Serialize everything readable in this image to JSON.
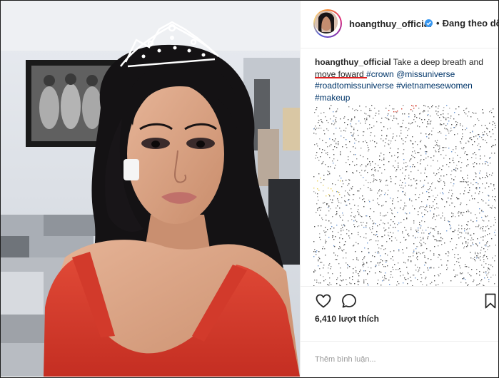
{
  "header": {
    "username": "hoangthuy_official",
    "follow_separator": "•",
    "follow_label": "Đang theo dõ",
    "verified_icon": "verified-badge-icon"
  },
  "caption": {
    "username": "hoangthuy_official",
    "text_1": " Take a deep breath and ",
    "text_2": "move foward",
    "hashtag_crown": "#crown",
    "mention": "@missuniverse",
    "hashtag_road": "#roadtomissuniverse",
    "hashtag_vn": "#vietnamesewomen",
    "hashtag_makeup": "#makeup"
  },
  "actions": {
    "like_icon": "heart-icon",
    "comment_icon": "comment-icon",
    "save_icon": "bookmark-icon"
  },
  "likes": {
    "count_text": "6,410 lượt thích"
  },
  "comment_box": {
    "placeholder": "Thêm bình luận..."
  },
  "colors": {
    "hashtag": "#003569",
    "verified": "#3897f0",
    "divider": "#efefef",
    "annotation_red": "#e02020",
    "dress_red": "#d8392b"
  }
}
